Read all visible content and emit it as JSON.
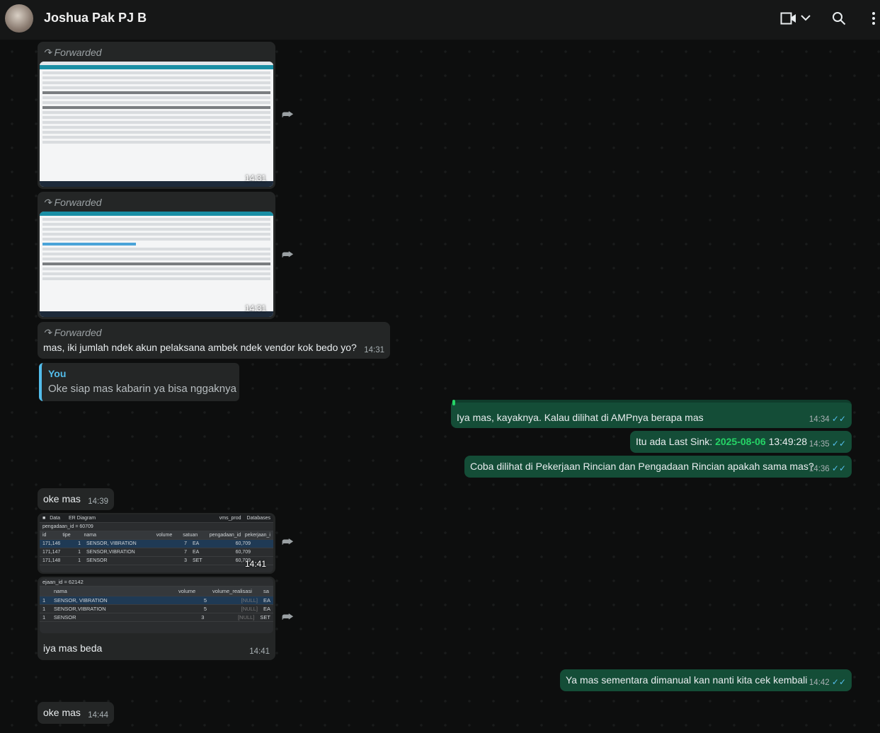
{
  "header": {
    "contact_name": "Joshua Pak PJ B",
    "icons": [
      "video-call-icon",
      "chevron-down-icon",
      "search-icon",
      "menu-icon"
    ]
  },
  "forwarded_label": "Forwarded",
  "messages": {
    "m1": {
      "time": "14:31"
    },
    "m2": {
      "time": "14:31"
    },
    "m3": {
      "text": "mas, iki jumlah ndek akun pelaksana ambek ndek vendor kok bedo yo?",
      "time": "14:31"
    },
    "quote": {
      "author": "You",
      "text": "Oke siap mas kabarin ya bisa nggaknya"
    },
    "m4": {
      "text": "Iya mas, kayaknya. Kalau dilihat di AMPnya berapa mas",
      "time": "14:34"
    },
    "m5": {
      "text_before": "Itu ada Last Sink: ",
      "date": "2025-08-06",
      "text_after": " 13:49:28",
      "time": "14:35"
    },
    "m6": {
      "text": "Coba dilihat di Pekerjaan Rincian dan Pengadaan Rincian apakah sama mas?",
      "time": "14:36"
    },
    "m7": {
      "text": "oke mas",
      "time": "14:39"
    },
    "m8": {
      "time": "14:41",
      "tabs": [
        "Data",
        "ER Diagram",
        "vms_prod",
        "Databases"
      ],
      "filter": "pengadaan_id = 60709",
      "columns": [
        "id",
        "tipe",
        "nama",
        "volume",
        "satuan",
        "pengadaan_id",
        "pekerjaan_i"
      ],
      "rows": [
        [
          "171,146",
          "1",
          "SENSOR, VIBRATION",
          "7",
          "EA",
          "60,709"
        ],
        [
          "171,147",
          "1",
          "SENSOR,VIBRATION",
          "7",
          "EA",
          "60,709"
        ],
        [
          "171,148",
          "1",
          "SENSOR",
          "3",
          "SET",
          "60,709"
        ]
      ]
    },
    "m9": {
      "text": "iya mas beda",
      "time": "14:41",
      "filter": "ejaan_id = 62142",
      "columns": [
        "nama",
        "volume",
        "volume_realisasi",
        "sa"
      ],
      "rows": [
        [
          "1",
          "SENSOR, VIBRATION",
          "5",
          "[NULL]",
          "EA"
        ],
        [
          "1",
          "SENSOR,VIBRATION",
          "5",
          "[NULL]",
          "EA"
        ],
        [
          "1",
          "SENSOR",
          "3",
          "[NULL]",
          "SET"
        ]
      ]
    },
    "m10": {
      "text": "Ya mas sementara dimanual kan nanti kita cek kembali",
      "time": "14:42"
    },
    "m11": {
      "text": "oke mas",
      "time": "14:44"
    }
  },
  "colors": {
    "outgoing": "#144d37",
    "incoming": "#242626",
    "accent": "#25d366",
    "link_blue": "#53bdeb"
  }
}
